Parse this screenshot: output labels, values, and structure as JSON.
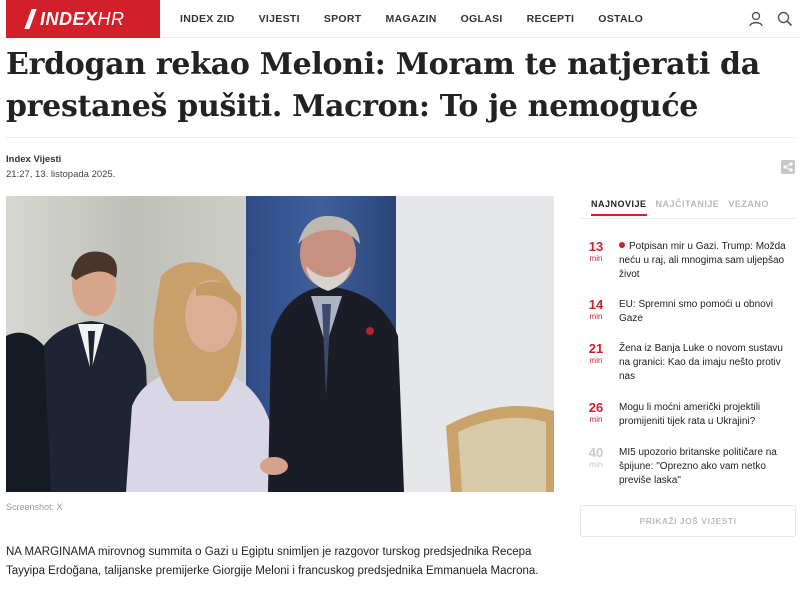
{
  "header": {
    "logo_main": "INDEX",
    "logo_suffix": "HR",
    "nav": [
      "INDEX ZID",
      "VIJESTI",
      "SPORT",
      "MAGAZIN",
      "OGLASI",
      "RECEPTI",
      "OSTALO"
    ],
    "icons": [
      "user-icon",
      "search-icon"
    ]
  },
  "article": {
    "headline": "Erdogan rekao Meloni: Moram te natjerati da prestaneš pušiti. Macron: To je nemoguće",
    "author": "Index Vijesti",
    "date": "21:27, 13. listopada 2025.",
    "photo_caption": "Screenshot: X",
    "body": "NA MARGINAMA mirovnog summita o Gazi u Egiptu snimljen je razgovor turskog predsjednika Recepa Tayyipa Erdoğana, talijanske premijerke Giorgije Meloni i francuskog predsjednika Emmanuela Macrona."
  },
  "sidebar": {
    "tabs": [
      "NAJNOVIJE",
      "NAJČITANIJE",
      "VEZANO"
    ],
    "news": [
      {
        "num": "13",
        "unit": "min",
        "text": "Potpisan mir u Gazi. Trump: Možda neću u raj, ali mnogima sam uljepšao život",
        "live": true
      },
      {
        "num": "14",
        "unit": "min",
        "text": "EU: Spremni smo pomoći u obnovi Gaze",
        "live": false
      },
      {
        "num": "21",
        "unit": "min",
        "text": "Žena iz Banja Luke o novom sustavu na granici: Kao da imaju nešto protiv nas",
        "live": false
      },
      {
        "num": "26",
        "unit": "min",
        "text": "Mogu li moćni američki projektili promijeniti tijek rata u Ukrajini?",
        "live": false
      },
      {
        "num": "40",
        "unit": "min",
        "text": "MI5 upozorio britanske političare na špijune: \"Oprezno ako vam netko previše laska\"",
        "live": false
      }
    ],
    "more_button": "PRIKAŽI JOŠ VIJESTI"
  },
  "colors": {
    "accent": "#d21f2a"
  }
}
